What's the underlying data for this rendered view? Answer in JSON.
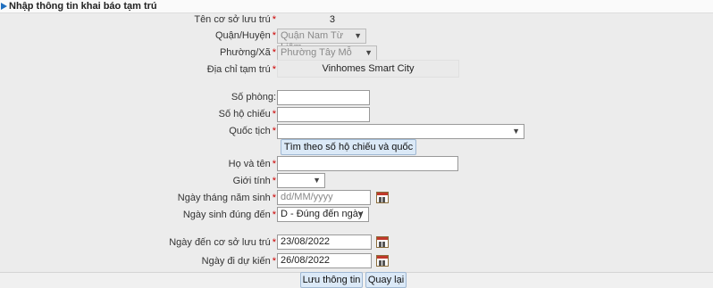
{
  "header": {
    "title": "Nhập thông tin khai báo tạm trú"
  },
  "fields": {
    "ten_co_so": {
      "label": "Tên cơ sở lưu trú",
      "req": "*",
      "value": "3"
    },
    "quan_huyen": {
      "label": "Quận/Huyện",
      "req": "*",
      "value": "Quận Nam Từ Liêm"
    },
    "phuong_xa": {
      "label": "Phường/Xã",
      "req": "*",
      "value": "Phường Tây Mỗ"
    },
    "dia_chi": {
      "label": "Địa chỉ tạm trú",
      "req": "*",
      "value": "Vinhomes Smart City"
    },
    "so_phong": {
      "label": "Số phòng:",
      "value": ""
    },
    "so_ho_chieu": {
      "label": "Số hộ chiếu",
      "req": "*",
      "value": ""
    },
    "quoc_tich": {
      "label": "Quốc tịch",
      "req": "*",
      "value": ""
    },
    "tim_button": "Tìm theo số hộ chiếu và quốc tịch",
    "ho_va_ten": {
      "label": "Họ và tên",
      "req": "*",
      "value": ""
    },
    "gioi_tinh": {
      "label": "Giới tính",
      "req": "*",
      "value": ""
    },
    "ngay_sinh": {
      "label": "Ngày tháng năm sinh",
      "req": "*",
      "placeholder": "dd/MM/yyyy"
    },
    "ngay_sinh_dung_den": {
      "label": "Ngày sinh đúng đến",
      "req": "*",
      "value": "D - Đúng đến ngày"
    },
    "ngay_den": {
      "label": "Ngày đến cơ sở lưu trú",
      "req": "*",
      "value": "23/08/2022"
    },
    "ngay_di": {
      "label": "Ngày đi dự kiến",
      "req": "*",
      "value": "26/08/2022"
    }
  },
  "buttons": {
    "save": "Lưu thông tin",
    "back": "Quay lại"
  }
}
